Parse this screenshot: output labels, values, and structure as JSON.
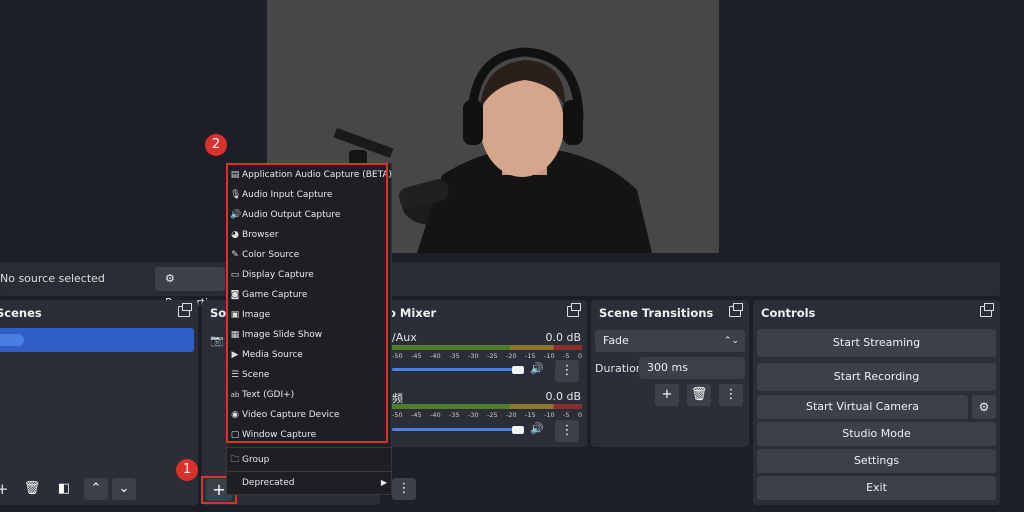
{
  "context_bar": {
    "no_source": "No source selected",
    "properties": "Properties"
  },
  "scenes": {
    "title": "Scenes"
  },
  "sources": {
    "title": "So"
  },
  "mixer": {
    "title": "o Mixer",
    "channels": [
      {
        "name": "/Aux",
        "db": "0.0 dB"
      },
      {
        "name": "频",
        "db": "0.0 dB"
      }
    ],
    "scale": [
      "-60",
      "-55",
      "-50",
      "-45",
      "-40",
      "-35",
      "-30",
      "-25",
      "-20",
      "-15",
      "-10",
      "-5",
      "0"
    ]
  },
  "transitions": {
    "title": "Scene Transitions",
    "type": "Fade",
    "duration_label": "Duration",
    "duration_value": "300 ms"
  },
  "controls": {
    "title": "Controls",
    "start_streaming": "Start Streaming",
    "start_recording": "Start Recording",
    "start_virtual_camera": "Start Virtual Camera",
    "studio_mode": "Studio Mode",
    "settings": "Settings",
    "exit": "Exit"
  },
  "menu": {
    "items": [
      {
        "label": "Application Audio Capture (BETA)",
        "icon": "app-audio-icon"
      },
      {
        "label": "Audio Input Capture",
        "icon": "microphone-icon"
      },
      {
        "label": "Audio Output Capture",
        "icon": "speaker-icon"
      },
      {
        "label": "Browser",
        "icon": "globe-icon"
      },
      {
        "label": "Color Source",
        "icon": "brush-icon"
      },
      {
        "label": "Display Capture",
        "icon": "monitor-icon"
      },
      {
        "label": "Game Capture",
        "icon": "gamepad-icon"
      },
      {
        "label": "Image",
        "icon": "image-icon"
      },
      {
        "label": "Image Slide Show",
        "icon": "slideshow-icon"
      },
      {
        "label": "Media Source",
        "icon": "play-icon"
      },
      {
        "label": "Scene",
        "icon": "list-icon"
      },
      {
        "label": "Text (GDI+)",
        "icon": "text-icon"
      },
      {
        "label": "Video Capture Device",
        "icon": "camera-icon"
      },
      {
        "label": "Window Capture",
        "icon": "window-icon"
      }
    ],
    "group": "Group",
    "deprecated": "Deprecated"
  },
  "annotations": {
    "badge_1": "1",
    "badge_2": "2"
  },
  "colors": {
    "highlight": "#d9322c",
    "scene_selected": "#2f5fc4",
    "accent": "#4a7ee0"
  }
}
